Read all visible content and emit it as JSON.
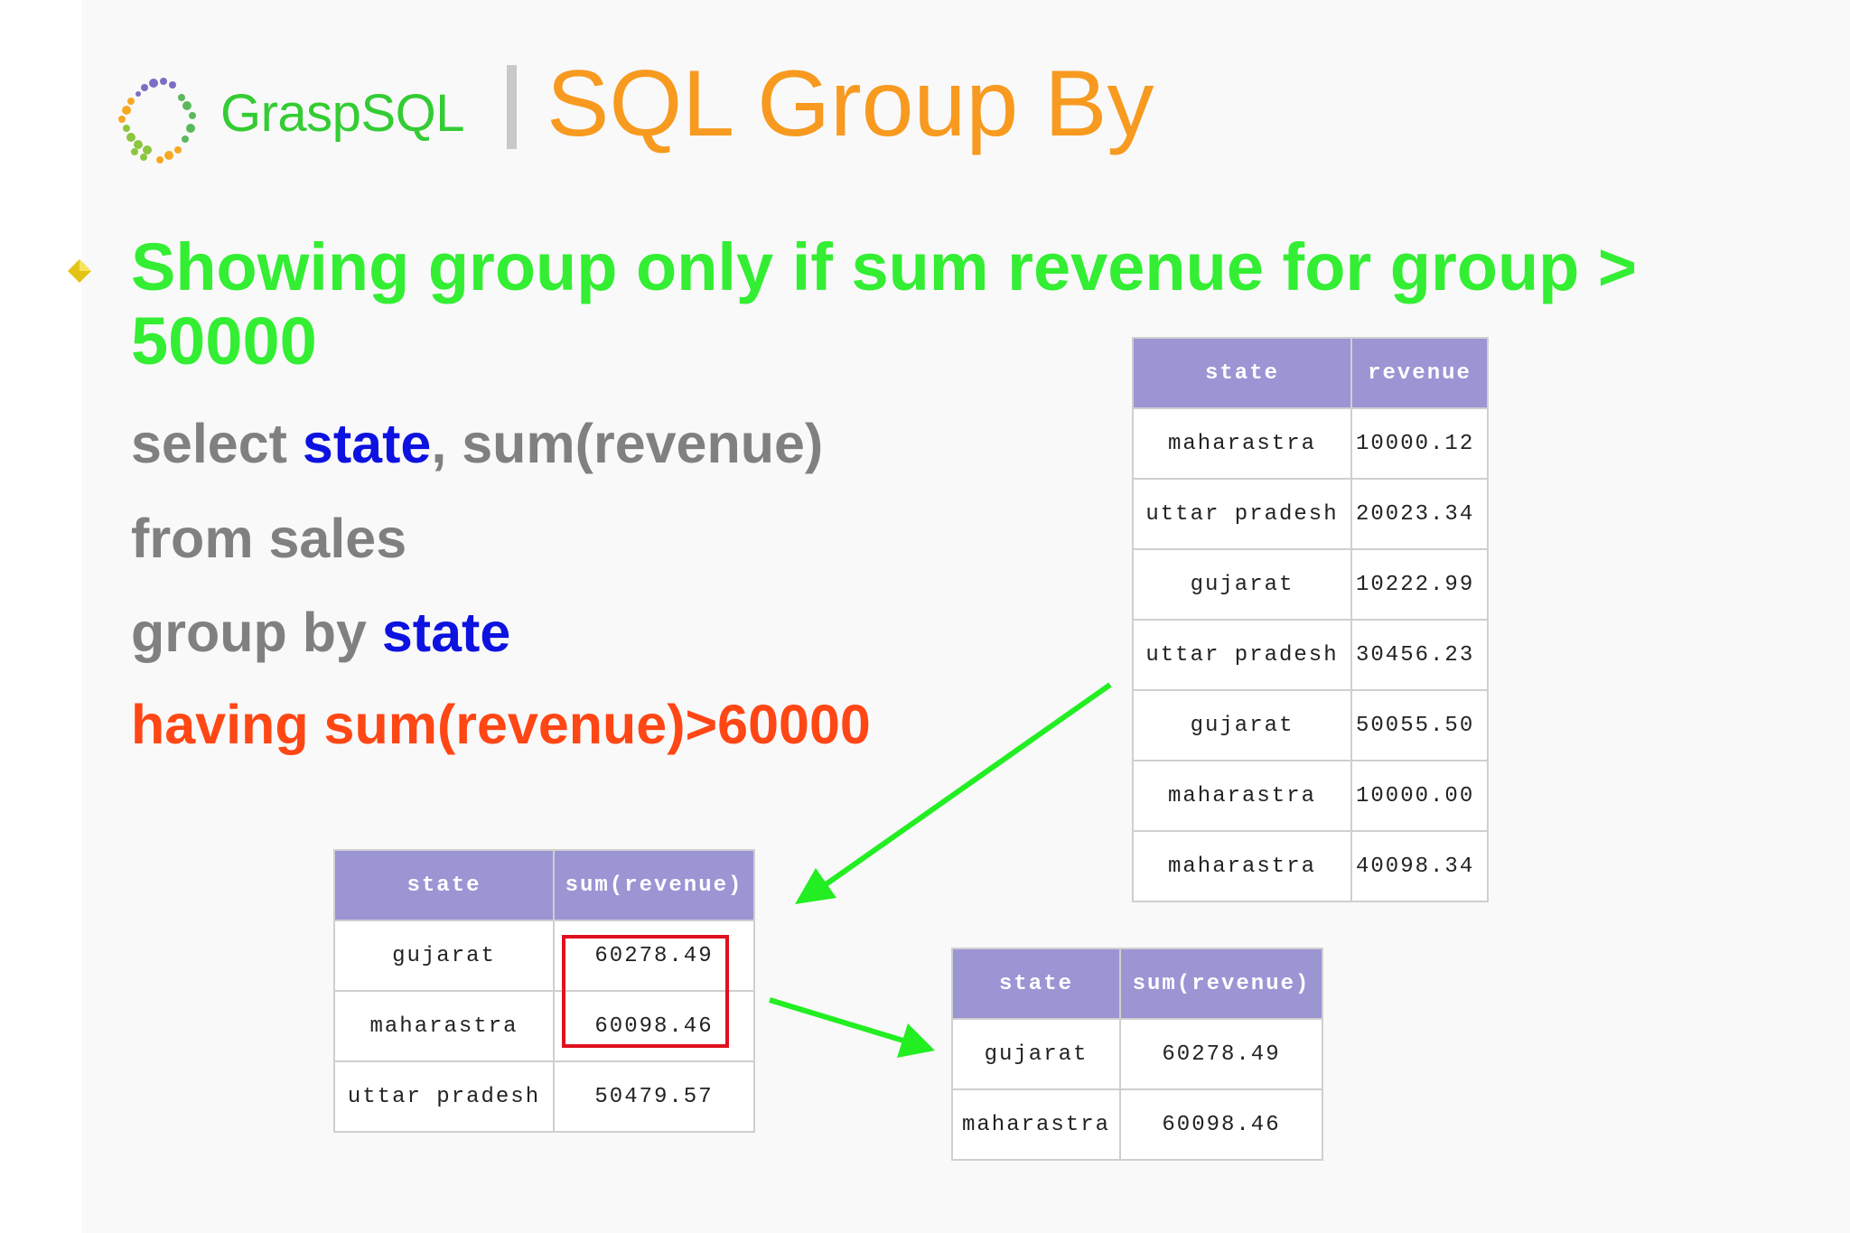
{
  "header": {
    "brand": "GraspSQL",
    "title": "SQL Group By",
    "colors": {
      "brand": "#33cc33",
      "title": "#f79a1f"
    }
  },
  "bullet": {
    "icon": "diamond-bullet-icon",
    "text": "Showing group only if sum revenue for group > 50000"
  },
  "code": {
    "line1": {
      "pre": "select ",
      "kw": "state",
      "post": ", sum(revenue)"
    },
    "line2": "from sales",
    "line3": {
      "pre": "group by ",
      "kw": "state"
    },
    "line4": "having sum(revenue)>60000",
    "colors": {
      "text": "#808080",
      "keyword": "#0d12e0",
      "having": "#ff4615"
    }
  },
  "sales_table": {
    "headers": [
      "state",
      "revenue"
    ],
    "rows": [
      [
        "maharastra",
        "10000.12"
      ],
      [
        "uttar pradesh",
        "20023.34"
      ],
      [
        "gujarat",
        "10222.99"
      ],
      [
        "uttar pradesh",
        "30456.23"
      ],
      [
        "gujarat",
        "50055.50"
      ],
      [
        "maharastra",
        "10000.00"
      ],
      [
        "maharastra",
        "40098.34"
      ]
    ]
  },
  "grouped_table": {
    "headers": [
      "state",
      "sum(revenue)"
    ],
    "rows": [
      [
        "gujarat",
        "60278.49"
      ],
      [
        "maharastra",
        "60098.46"
      ],
      [
        "uttar pradesh",
        "50479.57"
      ]
    ]
  },
  "having_table": {
    "headers": [
      "state",
      "sum(revenue)"
    ],
    "rows": [
      [
        "gujarat",
        "60278.49"
      ],
      [
        "maharastra",
        "60098.46"
      ]
    ]
  },
  "colors": {
    "table_header": "#9b95d4",
    "arrow": "#22ee22",
    "highlight": "#e01020"
  }
}
